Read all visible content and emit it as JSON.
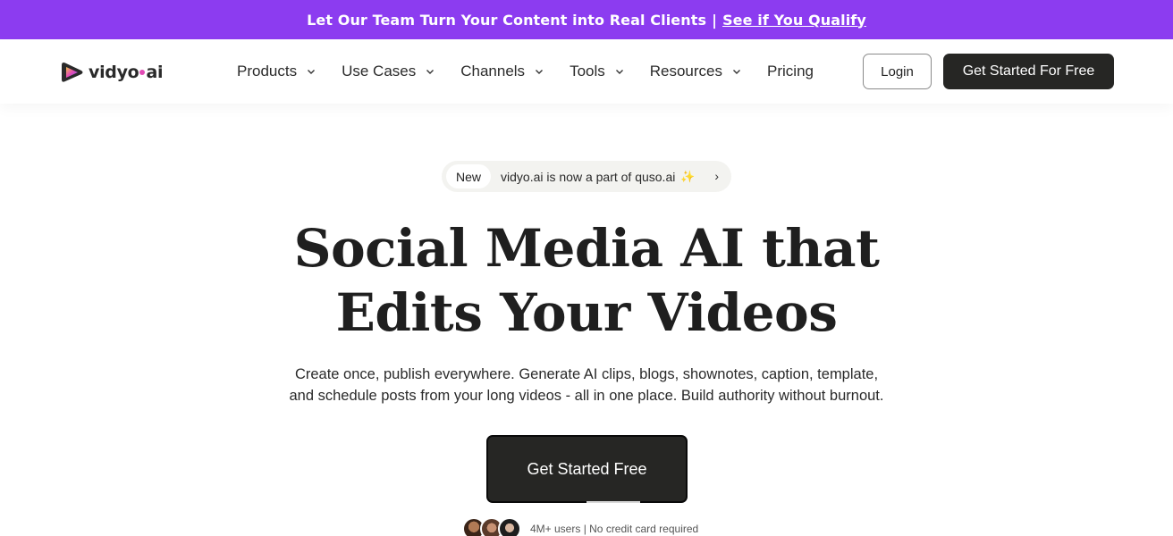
{
  "promo": {
    "text": "Let Our Team Turn Your Content into Real Clients",
    "separator": "|",
    "link": "See if You Qualify",
    "background": "#8c3cf0"
  },
  "nav": {
    "logo_text": "vidyo",
    "logo_suffix": "ai",
    "menu": [
      {
        "label": "Products",
        "has_dropdown": true
      },
      {
        "label": "Use Cases",
        "has_dropdown": true
      },
      {
        "label": "Channels",
        "has_dropdown": true
      },
      {
        "label": "Tools",
        "has_dropdown": true
      },
      {
        "label": "Resources",
        "has_dropdown": true
      },
      {
        "label": "Pricing",
        "has_dropdown": false
      }
    ],
    "login": "Login",
    "cta": "Get Started For Free"
  },
  "hero": {
    "badge": {
      "tag": "New",
      "text": "vidyo.ai is now a part of quso.ai",
      "icon": "sparkle-icon",
      "arrow": "›"
    },
    "headline_line1": "Social Media AI that",
    "headline_line2": "Edits Your Videos",
    "sub_line1": "Create once, publish everywhere. Generate AI clips, blogs, shownotes, caption, template,",
    "sub_line2": "and schedule posts from your long videos - all in one place. Build authority without burnout.",
    "cta": "Get Started Free",
    "social_proof": "4M+ users | No credit card required"
  },
  "colors": {
    "accent_purple": "#8c3cf0",
    "button_dark": "#262624",
    "logo_pink": "#e24bb5"
  }
}
